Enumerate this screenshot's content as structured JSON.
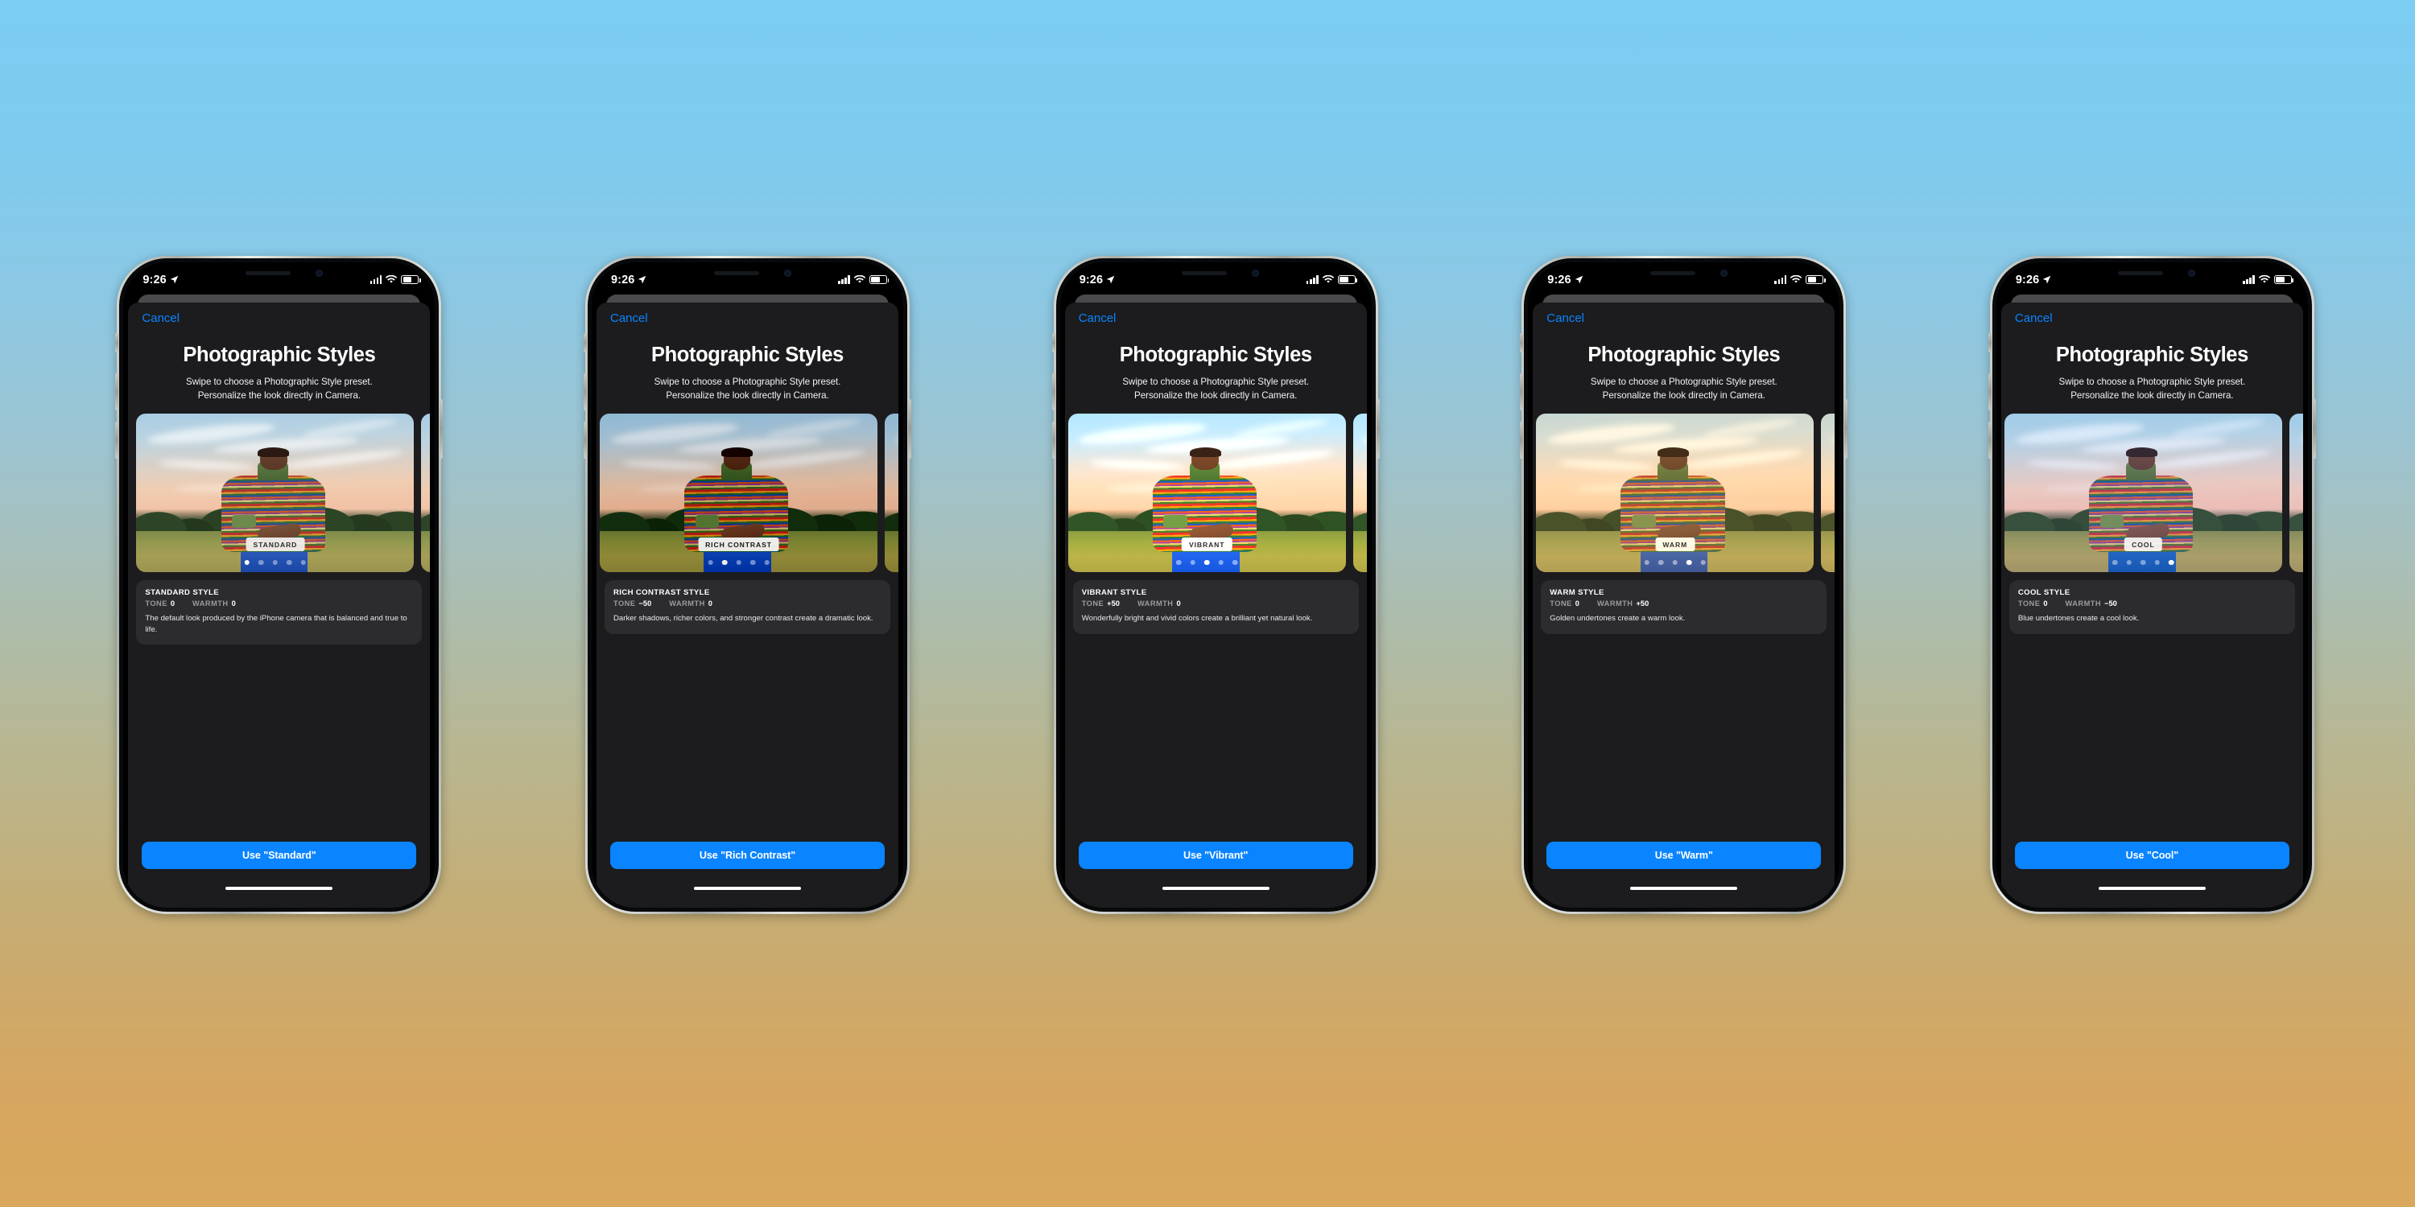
{
  "background": {
    "top_color": "#7ccdf2",
    "bottom_color": "#d9a85e"
  },
  "accent_color": "#0a84ff",
  "status_bar": {
    "time": "9:26",
    "location_icon": "location-arrow-icon",
    "cellular_icon": "cellular-bars-icon",
    "wifi_icon": "wifi-icon",
    "battery_icon": "battery-icon",
    "battery_level_percent": 55
  },
  "sheet": {
    "cancel_label": "Cancel",
    "title": "Photographic Styles",
    "subtitle_line1": "Swipe to choose a Photographic Style preset.",
    "subtitle_line2": "Personalize the look directly in Camera."
  },
  "labels": {
    "tone": "TONE",
    "warmth": "WARMTH"
  },
  "phones": [
    {
      "id": "standard",
      "badge": "STANDARD",
      "active_dot": 0,
      "dot_count": 5,
      "info_title": "STANDARD STYLE",
      "tone": "0",
      "warmth": "0",
      "description": "The default look produced by the iPhone camera that is balanced and true to life.",
      "button_label": "Use \"Standard\""
    },
    {
      "id": "rich-contrast",
      "badge": "RICH CONTRAST",
      "active_dot": 1,
      "dot_count": 5,
      "info_title": "RICH CONTRAST STYLE",
      "tone": "−50",
      "warmth": "0",
      "description": "Darker shadows, richer colors, and stronger contrast create a dramatic look.",
      "button_label": "Use \"Rich Contrast\""
    },
    {
      "id": "vibrant",
      "badge": "VIBRANT",
      "active_dot": 2,
      "dot_count": 5,
      "info_title": "VIBRANT STYLE",
      "tone": "+50",
      "warmth": "0",
      "description": "Wonderfully bright and vivid colors create a brilliant yet natural look.",
      "button_label": "Use \"Vibrant\""
    },
    {
      "id": "warm",
      "badge": "WARM",
      "active_dot": 3,
      "dot_count": 5,
      "info_title": "WARM STYLE",
      "tone": "0",
      "warmth": "+50",
      "description": "Golden undertones create a warm look.",
      "button_label": "Use \"Warm\""
    },
    {
      "id": "cool",
      "badge": "COOL",
      "active_dot": 4,
      "dot_count": 5,
      "info_title": "COOL STYLE",
      "tone": "0",
      "warmth": "−50",
      "description": "Blue undertones create a cool look.",
      "button_label": "Use \"Cool\""
    }
  ]
}
